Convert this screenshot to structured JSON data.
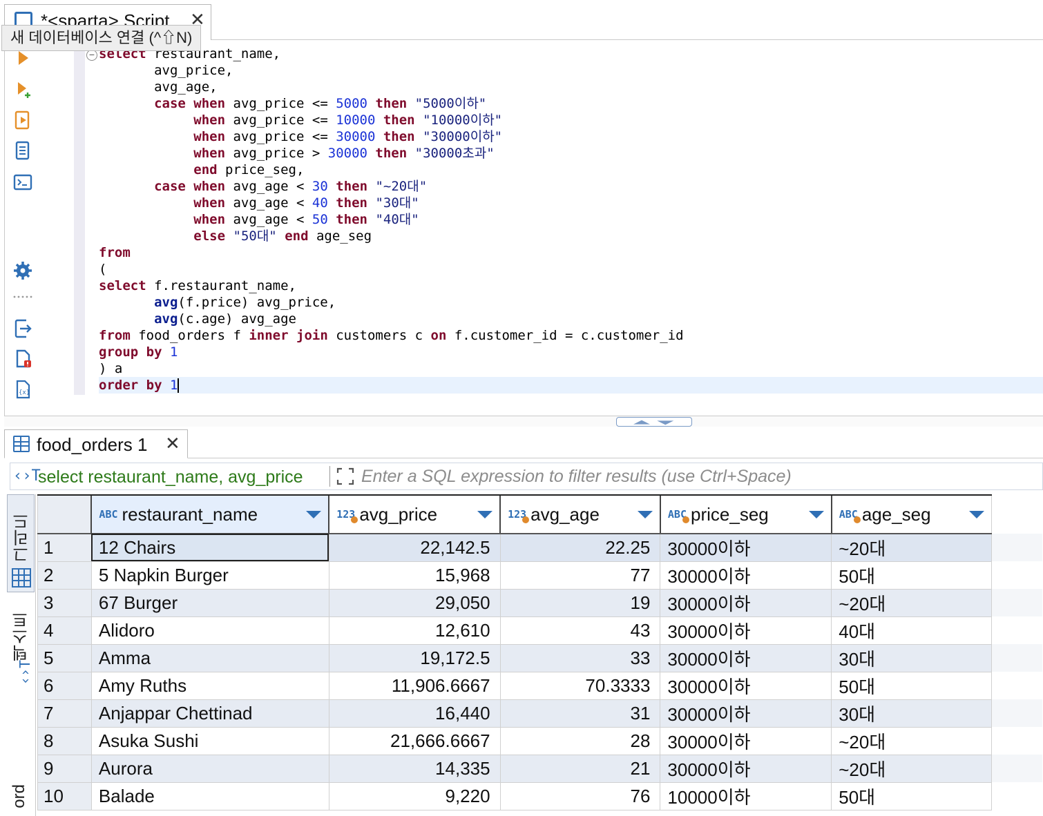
{
  "editor": {
    "tab_title": "*<sparta> Script",
    "tab_close": "✕",
    "tooltip": "새 데이터베이스 연결 (^⇧N)"
  },
  "sql_lines": [
    [
      {
        "t": "k",
        "v": "select"
      },
      {
        "t": "p",
        "v": " restaurant_name,"
      }
    ],
    [
      {
        "t": "p",
        "v": "       avg_price,"
      }
    ],
    [
      {
        "t": "p",
        "v": "       avg_age,"
      }
    ],
    [
      {
        "t": "p",
        "v": "       "
      },
      {
        "t": "k",
        "v": "case"
      },
      {
        "t": "p",
        "v": " "
      },
      {
        "t": "k",
        "v": "when"
      },
      {
        "t": "p",
        "v": " avg_price <= "
      },
      {
        "t": "n",
        "v": "5000"
      },
      {
        "t": "p",
        "v": " "
      },
      {
        "t": "k",
        "v": "then"
      },
      {
        "t": "p",
        "v": " "
      },
      {
        "t": "s",
        "v": "\"5000이하\""
      }
    ],
    [
      {
        "t": "p",
        "v": "            "
      },
      {
        "t": "k",
        "v": "when"
      },
      {
        "t": "p",
        "v": " avg_price <= "
      },
      {
        "t": "n",
        "v": "10000"
      },
      {
        "t": "p",
        "v": " "
      },
      {
        "t": "k",
        "v": "then"
      },
      {
        "t": "p",
        "v": " "
      },
      {
        "t": "s",
        "v": "\"10000이하\""
      }
    ],
    [
      {
        "t": "p",
        "v": "            "
      },
      {
        "t": "k",
        "v": "when"
      },
      {
        "t": "p",
        "v": " avg_price <= "
      },
      {
        "t": "n",
        "v": "30000"
      },
      {
        "t": "p",
        "v": " "
      },
      {
        "t": "k",
        "v": "then"
      },
      {
        "t": "p",
        "v": " "
      },
      {
        "t": "s",
        "v": "\"30000이하\""
      }
    ],
    [
      {
        "t": "p",
        "v": "            "
      },
      {
        "t": "k",
        "v": "when"
      },
      {
        "t": "p",
        "v": " avg_price > "
      },
      {
        "t": "n",
        "v": "30000"
      },
      {
        "t": "p",
        "v": " "
      },
      {
        "t": "k",
        "v": "then"
      },
      {
        "t": "p",
        "v": " "
      },
      {
        "t": "s",
        "v": "\"30000초과\""
      }
    ],
    [
      {
        "t": "p",
        "v": "            "
      },
      {
        "t": "k",
        "v": "end"
      },
      {
        "t": "p",
        "v": " price_seg,"
      }
    ],
    [
      {
        "t": "p",
        "v": "       "
      },
      {
        "t": "k",
        "v": "case"
      },
      {
        "t": "p",
        "v": " "
      },
      {
        "t": "k",
        "v": "when"
      },
      {
        "t": "p",
        "v": " avg_age < "
      },
      {
        "t": "n",
        "v": "30"
      },
      {
        "t": "p",
        "v": " "
      },
      {
        "t": "k",
        "v": "then"
      },
      {
        "t": "p",
        "v": " "
      },
      {
        "t": "s",
        "v": "\"~20대\""
      }
    ],
    [
      {
        "t": "p",
        "v": "            "
      },
      {
        "t": "k",
        "v": "when"
      },
      {
        "t": "p",
        "v": " avg_age < "
      },
      {
        "t": "n",
        "v": "40"
      },
      {
        "t": "p",
        "v": " "
      },
      {
        "t": "k",
        "v": "then"
      },
      {
        "t": "p",
        "v": " "
      },
      {
        "t": "s",
        "v": "\"30대\""
      }
    ],
    [
      {
        "t": "p",
        "v": "            "
      },
      {
        "t": "k",
        "v": "when"
      },
      {
        "t": "p",
        "v": " avg_age < "
      },
      {
        "t": "n",
        "v": "50"
      },
      {
        "t": "p",
        "v": " "
      },
      {
        "t": "k",
        "v": "then"
      },
      {
        "t": "p",
        "v": " "
      },
      {
        "t": "s",
        "v": "\"40대\""
      }
    ],
    [
      {
        "t": "p",
        "v": "            "
      },
      {
        "t": "k",
        "v": "else"
      },
      {
        "t": "p",
        "v": " "
      },
      {
        "t": "s",
        "v": "\"50대\""
      },
      {
        "t": "p",
        "v": " "
      },
      {
        "t": "k",
        "v": "end"
      },
      {
        "t": "p",
        "v": " age_seg"
      }
    ],
    [
      {
        "t": "k",
        "v": "from"
      }
    ],
    [
      {
        "t": "p",
        "v": "("
      }
    ],
    [
      {
        "t": "k",
        "v": "select"
      },
      {
        "t": "p",
        "v": " f.restaurant_name,"
      }
    ],
    [
      {
        "t": "p",
        "v": "       "
      },
      {
        "t": "f",
        "v": "avg"
      },
      {
        "t": "p",
        "v": "(f.price) avg_price,"
      }
    ],
    [
      {
        "t": "p",
        "v": "       "
      },
      {
        "t": "f",
        "v": "avg"
      },
      {
        "t": "p",
        "v": "(c.age) avg_age"
      }
    ],
    [
      {
        "t": "k",
        "v": "from"
      },
      {
        "t": "p",
        "v": " food_orders f "
      },
      {
        "t": "k",
        "v": "inner"
      },
      {
        "t": "p",
        "v": " "
      },
      {
        "t": "k",
        "v": "join"
      },
      {
        "t": "p",
        "v": " customers c "
      },
      {
        "t": "k",
        "v": "on"
      },
      {
        "t": "p",
        "v": " f.customer_id = c.customer_id"
      }
    ],
    [
      {
        "t": "k",
        "v": "group"
      },
      {
        "t": "p",
        "v": " "
      },
      {
        "t": "k",
        "v": "by"
      },
      {
        "t": "p",
        "v": " "
      },
      {
        "t": "n",
        "v": "1"
      }
    ],
    [
      {
        "t": "p",
        "v": ") a"
      }
    ],
    [
      {
        "t": "k",
        "v": "order"
      },
      {
        "t": "p",
        "v": " "
      },
      {
        "t": "k",
        "v": "by"
      },
      {
        "t": "p",
        "v": " "
      },
      {
        "t": "n",
        "v": "1"
      }
    ]
  ],
  "results": {
    "tab_title": "food_orders 1",
    "tab_close": "✕",
    "query_icon": "‹›T",
    "query_preview": "select restaurant_name, avg_price",
    "filter_placeholder": "Enter a SQL expression to filter results (use Ctrl+Space)",
    "vtab_grid": "그리드",
    "vtab_text": "텍스트",
    "vtab_record": "ord",
    "columns": [
      {
        "type": "ABC",
        "name": "restaurant_name",
        "align": "left"
      },
      {
        "type": "123",
        "name": "avg_price",
        "align": "right"
      },
      {
        "type": "123",
        "name": "avg_age",
        "align": "right"
      },
      {
        "type": "ABC",
        "name": "price_seg",
        "align": "left"
      },
      {
        "type": "ABC",
        "name": "age_seg",
        "align": "left"
      }
    ],
    "rows": [
      {
        "n": "1",
        "cells": [
          "12 Chairs",
          "22,142.5",
          "22.25",
          "30000이하",
          "~20대"
        ]
      },
      {
        "n": "2",
        "cells": [
          "5 Napkin Burger",
          "15,968",
          "77",
          "30000이하",
          "50대"
        ]
      },
      {
        "n": "3",
        "cells": [
          "67 Burger",
          "29,050",
          "19",
          "30000이하",
          "~20대"
        ]
      },
      {
        "n": "4",
        "cells": [
          "Alidoro",
          "12,610",
          "43",
          "30000이하",
          "40대"
        ]
      },
      {
        "n": "5",
        "cells": [
          "Amma",
          "19,172.5",
          "33",
          "30000이하",
          "30대"
        ]
      },
      {
        "n": "6",
        "cells": [
          "Amy Ruths",
          "11,906.6667",
          "70.3333",
          "30000이하",
          "50대"
        ]
      },
      {
        "n": "7",
        "cells": [
          "Anjappar Chettinad",
          "16,440",
          "31",
          "30000이하",
          "30대"
        ]
      },
      {
        "n": "8",
        "cells": [
          "Asuka Sushi",
          "21,666.6667",
          "28",
          "30000이하",
          "~20대"
        ]
      },
      {
        "n": "9",
        "cells": [
          "Aurora",
          "14,335",
          "21",
          "30000이하",
          "~20대"
        ]
      },
      {
        "n": "10",
        "cells": [
          "Balade",
          "9,220",
          "76",
          "10000이하",
          "50대"
        ]
      }
    ]
  },
  "colors": {
    "keyword": "#7f0b2c",
    "number": "#1a32d6",
    "query_text": "#2d7a19",
    "accent": "#2f6fb5",
    "row_stripe": "#e6ebf3"
  }
}
